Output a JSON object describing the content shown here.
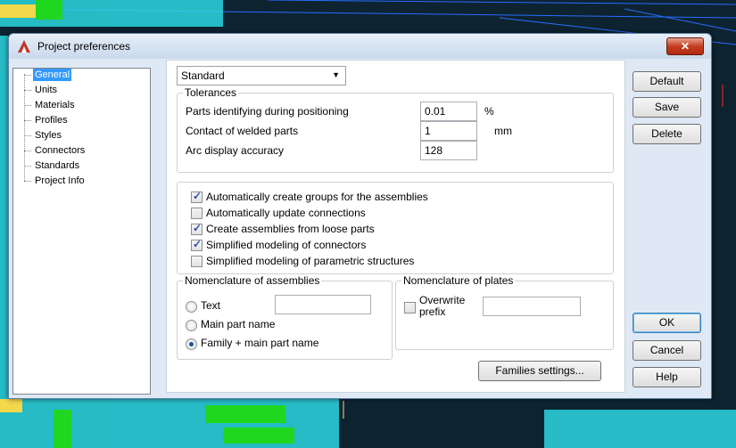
{
  "window": {
    "title": "Project preferences",
    "close_label": "✕"
  },
  "tree": {
    "items": [
      {
        "label": "General",
        "selected": true
      },
      {
        "label": "Units"
      },
      {
        "label": "Materials"
      },
      {
        "label": "Profiles"
      },
      {
        "label": "Styles"
      },
      {
        "label": "Connectors"
      },
      {
        "label": "Standards"
      },
      {
        "label": "Project Info"
      }
    ]
  },
  "standard_select": {
    "value": "Standard"
  },
  "tolerances": {
    "title": "Tolerances",
    "rows": [
      {
        "label": "Parts identifying during positioning",
        "value": "0.01",
        "unit": "%"
      },
      {
        "label": "Contact of welded parts",
        "value": "1",
        "unit": "mm"
      },
      {
        "label": "Arc display accuracy",
        "value": "128",
        "unit": ""
      }
    ]
  },
  "options": [
    {
      "label": "Automatically create groups for the assemblies",
      "checked": true
    },
    {
      "label": "Automatically update connections",
      "checked": false
    },
    {
      "label": "Create assemblies from loose parts",
      "checked": true
    },
    {
      "label": "Simplified modeling of connectors",
      "checked": true
    },
    {
      "label": "Simplified modeling of parametric structures",
      "checked": false
    }
  ],
  "nomenclature_assemblies": {
    "title": "Nomenclature of assemblies",
    "options": [
      {
        "label": "Text",
        "selected": false
      },
      {
        "label": "Main part name",
        "selected": false
      },
      {
        "label": "Family + main part name",
        "selected": true
      }
    ],
    "text_value": ""
  },
  "nomenclature_plates": {
    "title": "Nomenclature of plates",
    "overwrite_label_1": "Overwrite",
    "overwrite_label_2": "prefix",
    "overwrite_checked": false,
    "prefix_value": ""
  },
  "buttons": {
    "families_settings": "Families settings...",
    "default": "Default",
    "save": "Save",
    "delete": "Delete",
    "ok": "OK",
    "cancel": "Cancel",
    "help": "Help"
  }
}
